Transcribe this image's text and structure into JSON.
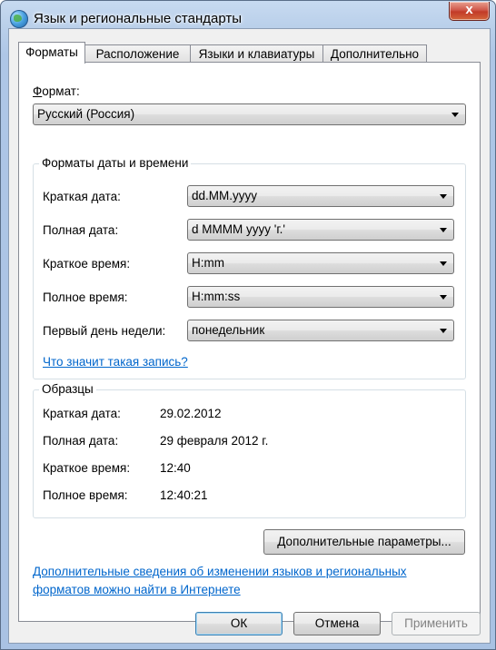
{
  "window": {
    "title": "Язык и региональные стандарты",
    "close_label": "x"
  },
  "tabs": [
    {
      "label": "Форматы",
      "active": true
    },
    {
      "label": "Расположение"
    },
    {
      "label": "Языки и клавиатуры"
    },
    {
      "label": "Дополнительно"
    }
  ],
  "format": {
    "label": "Формат:",
    "value": "Русский (Россия)"
  },
  "datetime": {
    "title": "Форматы даты и времени",
    "short_date_label": "Краткая дата:",
    "short_date_value": "dd.MM.yyyy",
    "long_date_label": "Полная дата:",
    "long_date_value": "d MMMM yyyy 'г.'",
    "short_time_label": "Краткое время:",
    "short_time_value": "H:mm",
    "long_time_label": "Полное время:",
    "long_time_value": "H:mm:ss",
    "first_day_label": "Первый день недели:",
    "first_day_value": "понедельник",
    "help_link": "Что значит такая запись?"
  },
  "samples": {
    "title": "Образцы",
    "short_date_label": "Краткая дата:",
    "short_date_value": "29.02.2012",
    "long_date_label": "Полная дата:",
    "long_date_value": "29 февраля 2012 г.",
    "short_time_label": "Краткое время:",
    "short_time_value": "12:40",
    "long_time_label": "Полное время:",
    "long_time_value": "12:40:21"
  },
  "additional_button": "Дополнительные параметры...",
  "info_link_line1": "Дополнительные сведения об изменении языков и региональных",
  "info_link_line2": "форматов можно найти в Интернете",
  "buttons": {
    "ok": "ОК",
    "cancel": "Отмена",
    "apply": "Применить"
  }
}
